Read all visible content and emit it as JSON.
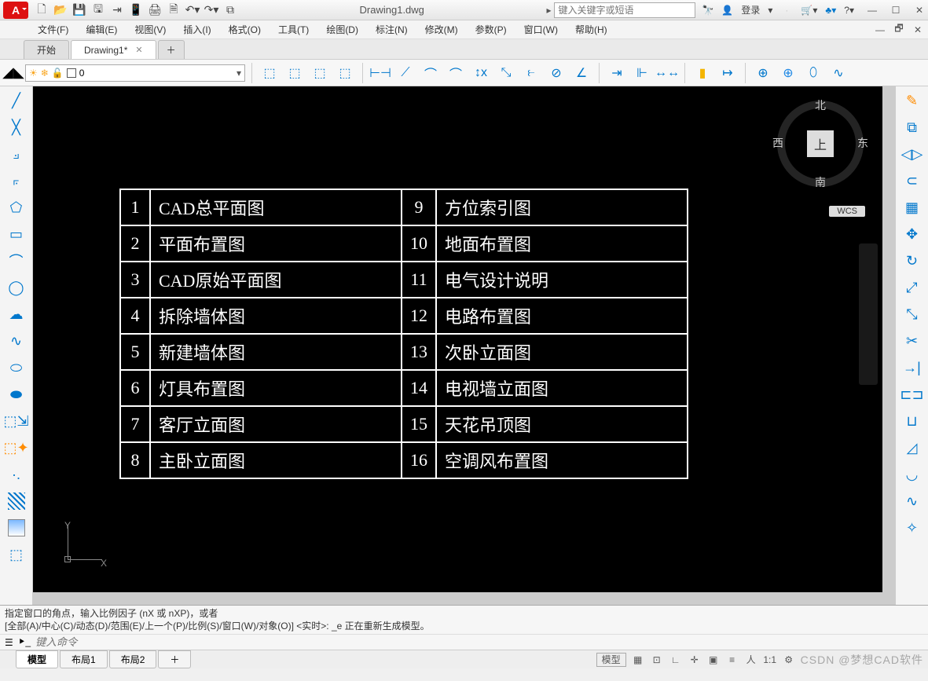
{
  "title": "Drawing1.dwg",
  "search_placeholder": "键入关键字或短语",
  "login": "登录",
  "menus": [
    "文件(F)",
    "编辑(E)",
    "视图(V)",
    "插入(I)",
    "格式(O)",
    "工具(T)",
    "绘图(D)",
    "标注(N)",
    "修改(M)",
    "参数(P)",
    "窗口(W)",
    "帮助(H)"
  ],
  "doc_tabs": {
    "start": "开始",
    "active": "Drawing1*"
  },
  "layer_current": "0",
  "viewcube": {
    "face": "上",
    "n": "北",
    "s": "南",
    "e": "东",
    "w": "西"
  },
  "wcs": "WCS",
  "ucs": {
    "x": "X",
    "y": "Y"
  },
  "table_rows": [
    {
      "n": "1",
      "t": "CAD总平面图"
    },
    {
      "n": "2",
      "t": "平面布置图"
    },
    {
      "n": "3",
      "t": "CAD原始平面图"
    },
    {
      "n": "4",
      "t": "拆除墙体图"
    },
    {
      "n": "5",
      "t": "新建墙体图"
    },
    {
      "n": "6",
      "t": "灯具布置图"
    },
    {
      "n": "7",
      "t": "客厅立面图"
    },
    {
      "n": "8",
      "t": "主卧立面图"
    },
    {
      "n": "9",
      "t": "方位索引图"
    },
    {
      "n": "10",
      "t": "地面布置图"
    },
    {
      "n": "11",
      "t": "电气设计说明"
    },
    {
      "n": "12",
      "t": "电路布置图"
    },
    {
      "n": "13",
      "t": "次卧立面图"
    },
    {
      "n": "14",
      "t": "电视墙立面图"
    },
    {
      "n": "15",
      "t": "天花吊顶图"
    },
    {
      "n": "16",
      "t": "空调风布置图"
    }
  ],
  "cmd_history": [
    "指定窗口的角点，输入比例因子 (nX 或 nXP)，或者",
    "[全部(A)/中心(C)/动态(D)/范围(E)/上一个(P)/比例(S)/窗口(W)/对象(O)] <实时>: _e 正在重新生成模型。"
  ],
  "cmd_placeholder": "键入命令",
  "layout_tabs": {
    "model": "模型",
    "l1": "布局1",
    "l2": "布局2"
  },
  "status": {
    "model_btn": "模型",
    "scale": "1:1",
    "watermark": "CSDN @梦想CAD软件"
  }
}
